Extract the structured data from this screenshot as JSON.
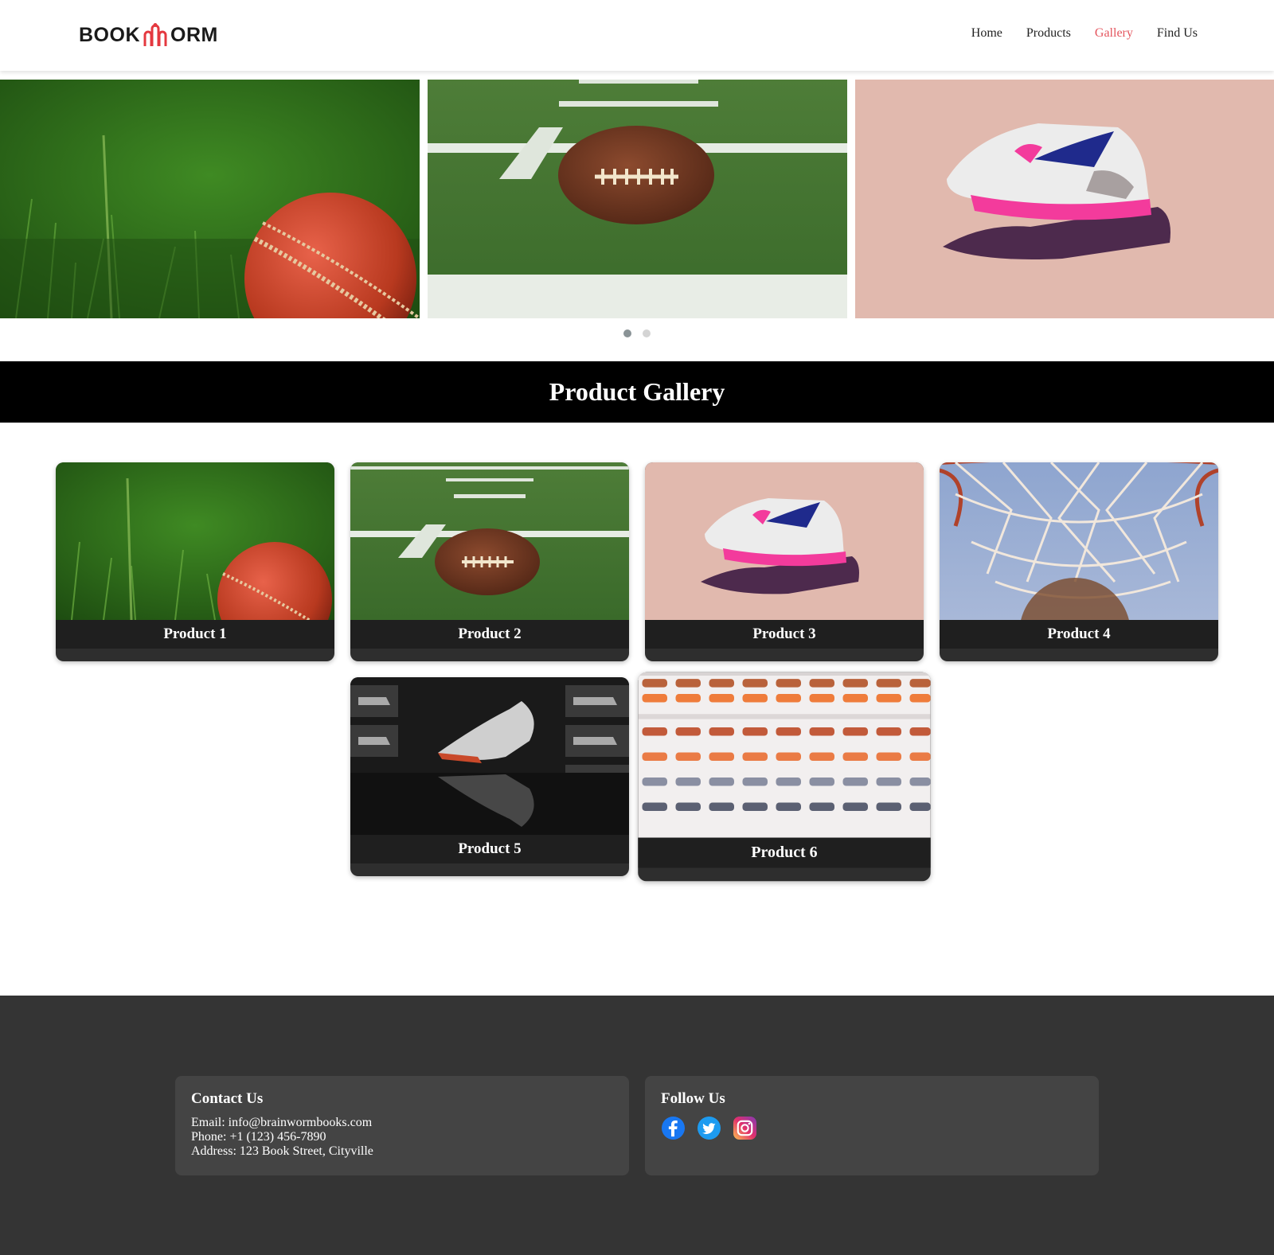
{
  "header": {
    "logo": {
      "left": "BOOK",
      "right": "ORM"
    },
    "nav": [
      {
        "label": "Home",
        "active": false
      },
      {
        "label": "Products",
        "active": false
      },
      {
        "label": "Gallery",
        "active": true
      },
      {
        "label": "Find Us",
        "active": false
      }
    ]
  },
  "carousel": {
    "slides": [
      "cricket-ball",
      "american-football",
      "sneaker-on-hand"
    ],
    "dots": 2,
    "active_dot": 0
  },
  "gallery": {
    "title": "Product Gallery",
    "products": [
      {
        "label": "Product 1",
        "image": "cricket-ball"
      },
      {
        "label": "Product 2",
        "image": "american-football"
      },
      {
        "label": "Product 3",
        "image": "sneaker-on-hand"
      },
      {
        "label": "Product 4",
        "image": "basketball-hoop"
      },
      {
        "label": "Product 5",
        "image": "football-boot-display"
      },
      {
        "label": "Product 6",
        "image": "shoe-wall"
      }
    ]
  },
  "footer": {
    "contact": {
      "title": "Contact Us",
      "email": "Email: info@brainwormbooks.com",
      "phone": "Phone: +1 (123) 456-7890",
      "address": "Address: 123 Book Street, Cityville"
    },
    "follow": {
      "title": "Follow Us",
      "icons": [
        "facebook-icon",
        "twitter-icon",
        "instagram-icon"
      ]
    }
  },
  "colors": {
    "accent": "#e4565f",
    "band": "#000000",
    "footer": "#343434",
    "footer_box": "#444444",
    "caption": "#1e1e1e"
  }
}
